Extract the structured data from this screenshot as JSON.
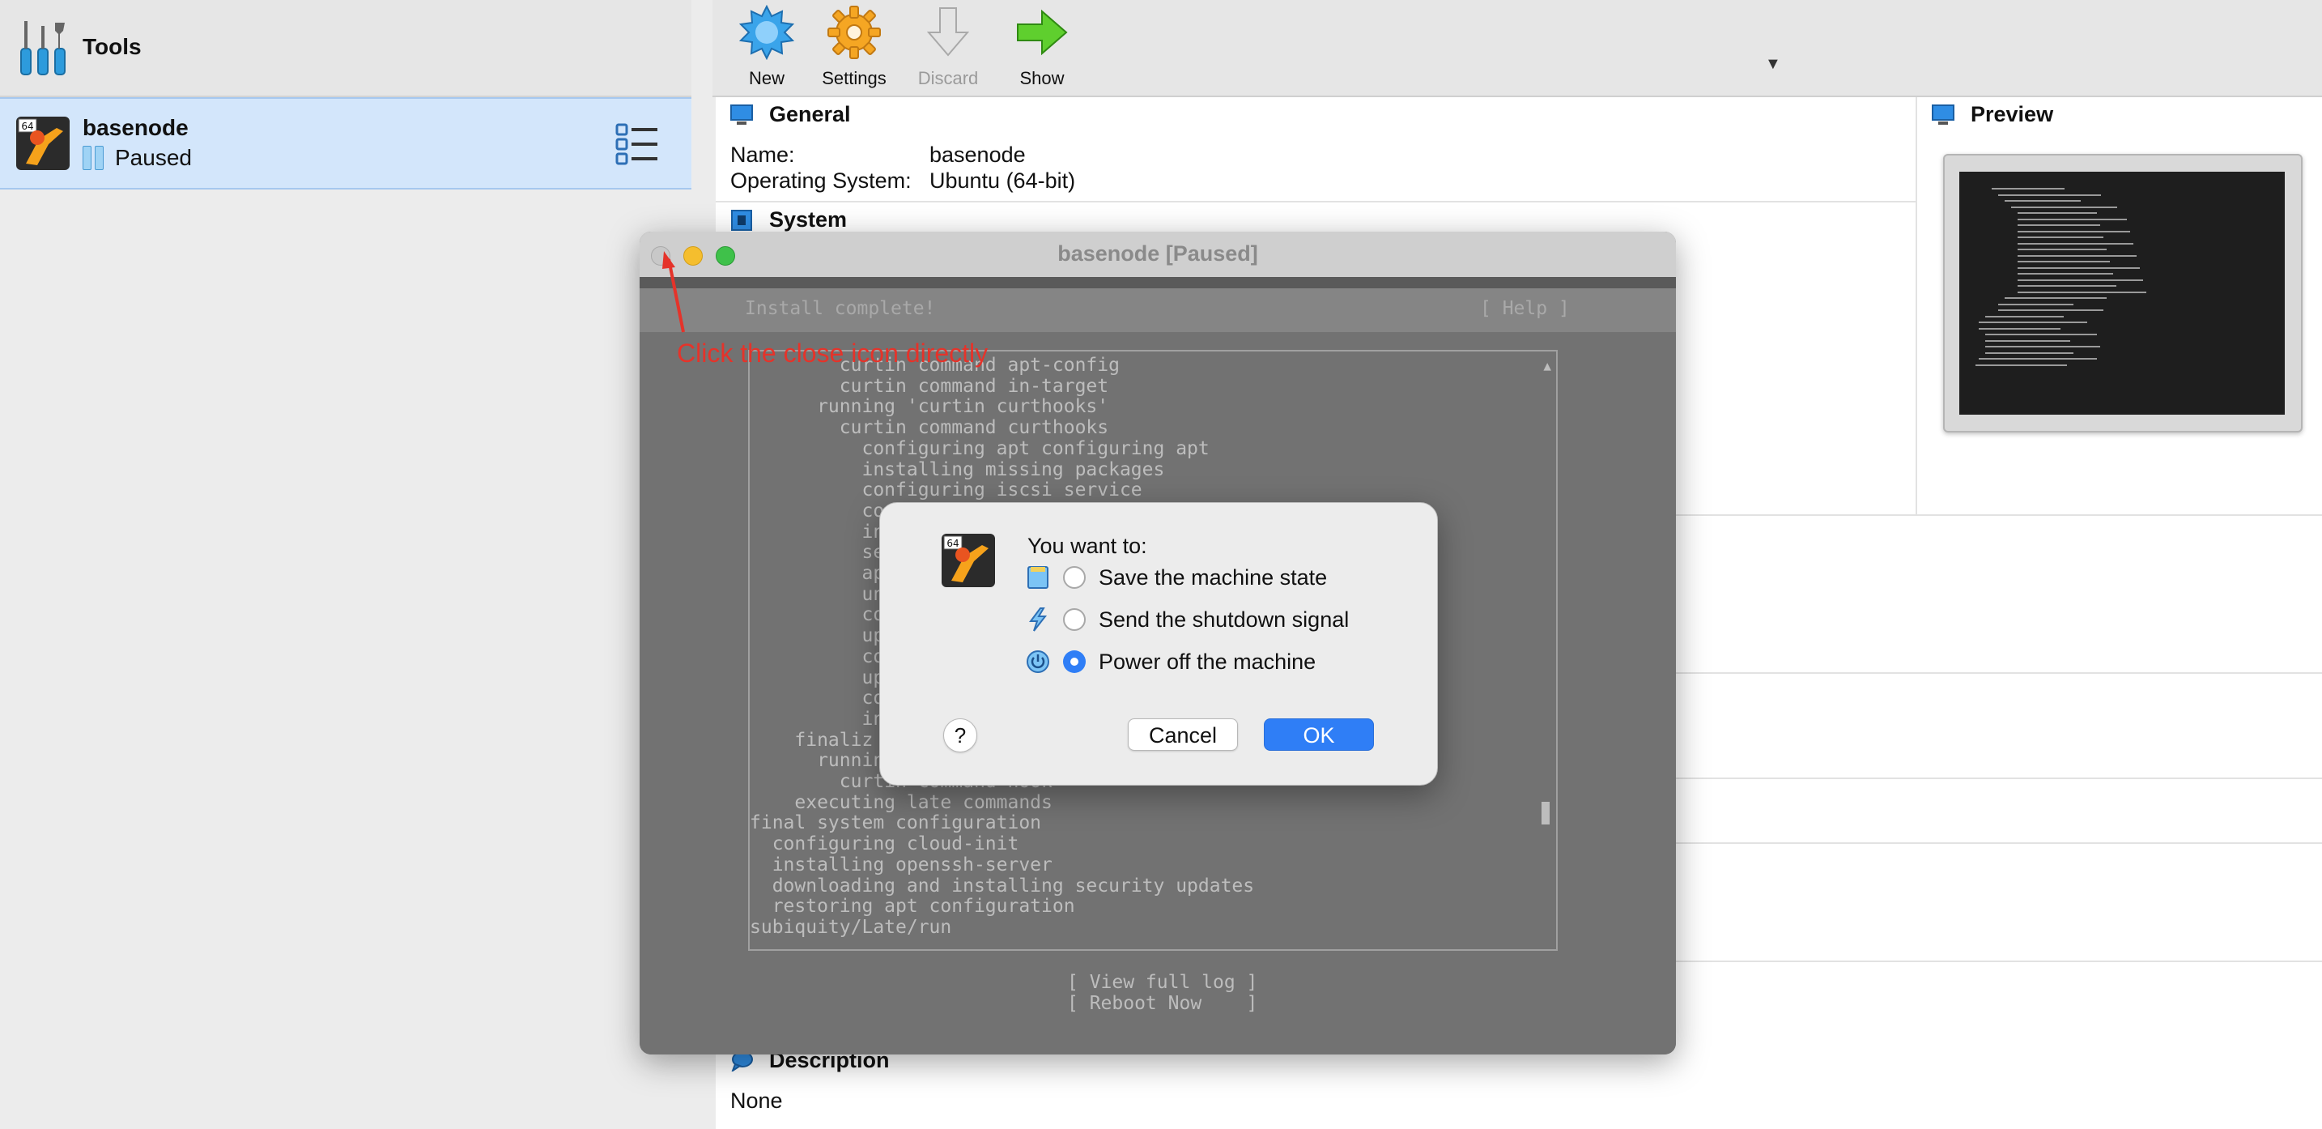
{
  "sidebar": {
    "tools_label": "Tools",
    "vm": {
      "name": "basenode",
      "state": "Paused",
      "badge": "64"
    }
  },
  "toolbar": {
    "items": [
      {
        "label": "New",
        "icon": "new-starburst-icon",
        "enabled": true
      },
      {
        "label": "Settings",
        "icon": "settings-gear-icon",
        "enabled": true
      },
      {
        "label": "Discard",
        "icon": "discard-arrow-icon",
        "enabled": false
      },
      {
        "label": "Show",
        "icon": "show-arrow-icon",
        "enabled": true
      }
    ],
    "caret": "▼"
  },
  "details": {
    "general": {
      "title": "General",
      "name_key": "Name:",
      "name_val": "basenode",
      "os_key": "Operating System:",
      "os_val": "Ubuntu (64-bit)"
    },
    "system": {
      "title": "System"
    },
    "preview": {
      "title": "Preview"
    },
    "description": {
      "title": "Description",
      "value": "None"
    }
  },
  "vm_window": {
    "title": "basenode [Paused]",
    "header_title": "Install complete!",
    "header_help": "[ Help ]",
    "log_lines": [
      "        curtin command apt-config",
      "        curtin command in-target",
      "      running 'curtin curthooks'",
      "        curtin command curthooks",
      "          configuring apt configuring apt",
      "          installing missing packages",
      "          configuring iscsi service",
      "          co",
      "          in",
      "          se",
      "          ap",
      "          un",
      "          co",
      "          up",
      "          co",
      "          up",
      "          co",
      "          in",
      "    finaliz",
      "      runnin",
      "        curtin command hook",
      "    executing late commands",
      "final system configuration",
      "  configuring cloud-init",
      "  installing openssh-server",
      "  downloading and installing security updates",
      "  restoring apt configuration",
      "subiquity/Late/run"
    ],
    "view_log": "[ View full log ]",
    "reboot": "[ Reboot Now    ]"
  },
  "annotation": "Click the close icon directly",
  "dialog": {
    "badge": "64",
    "title": "You want to:",
    "options": [
      {
        "label": "Save the machine state",
        "icon": "save-state-icon",
        "selected": false
      },
      {
        "label": "Send the shutdown signal",
        "icon": "shutdown-signal-icon",
        "selected": false
      },
      {
        "label": "Power off the machine",
        "icon": "power-off-icon",
        "selected": true
      }
    ],
    "help": "?",
    "cancel": "Cancel",
    "ok": "OK"
  },
  "colors": {
    "selection": "#d3e6fb",
    "accent": "#2f7ef6",
    "annotation": "#e5332a",
    "terminal": "#727272"
  }
}
